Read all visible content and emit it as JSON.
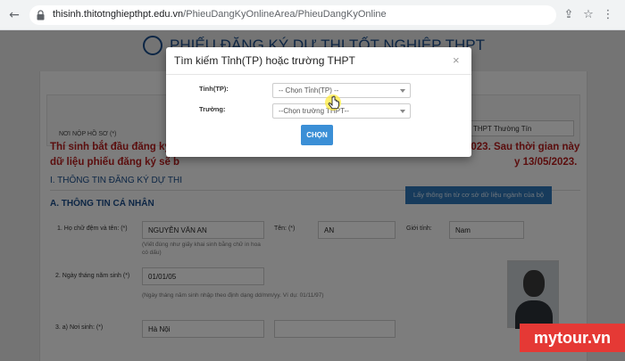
{
  "browser": {
    "url_host": "thisinh.thitotnghiepthpt.edu.vn",
    "url_path": "/PhieuDangKyOnlineArea/PhieuDangKyOnline"
  },
  "page": {
    "title": "PHIẾU ĐĂNG KÝ DỰ THI TỐT NGHIỆP THPT",
    "noi_nop_label": "NƠI NỘP HỒ SƠ (*)",
    "noi_nop_value": "THPT Thường Tín",
    "red_note_line1a": "Thí sinh bắt đầu đăng ký th",
    "red_note_line1b": "2023. Sau thời gian này",
    "red_note_line2a": "dữ liệu phiếu đăng ký sẽ b",
    "red_note_line2b": "y 13/05/2023.",
    "section1": "I. THÔNG TIN ĐĂNG KÝ DỰ THI",
    "section2": "A. THÔNG TIN CÁ NHÂN",
    "data_button": "Lấy thông tin từ cơ sở dữ liệu ngành của bộ",
    "field1_label": "1. Họ chữ đệm và tên: (*)",
    "field1_value": "NGUYỄN VĂN AN",
    "field1_hint": "(Viết đúng như giấy khai sinh bằng chữ in hoa có dấu)",
    "ten_label": "Tên: (*)",
    "ten_value": "AN",
    "gioitinh_label": "Giới tính:",
    "gioitinh_value": "Nam",
    "field2_label": "2. Ngày tháng năm sinh (*)",
    "field2_value": "01/01/05",
    "field2_hint": "(Ngày tháng năm sinh nhập theo định dạng dd/mm/yy. Ví dụ: 01/11/97)",
    "field3_label": "3. a) Nơi sinh: (*)",
    "field3_value": "Hà Nội"
  },
  "modal": {
    "title": "Tìm kiếm Tỉnh(TP) hoặc trường THPT",
    "close": "×",
    "tinh_label": "Tỉnh(TP):",
    "tinh_value": "-- Chọn Tỉnh(TP) --",
    "truong_label": "Trường:",
    "truong_value": "--Chọn trường THPT--",
    "chon_button": "CHỌN"
  },
  "watermark": "mytour.vn",
  "colors": {
    "accent": "#3b8fd6",
    "title_blue": "#1a4d8a",
    "note_red": "#b71c1c",
    "brand_red": "#e53935"
  }
}
